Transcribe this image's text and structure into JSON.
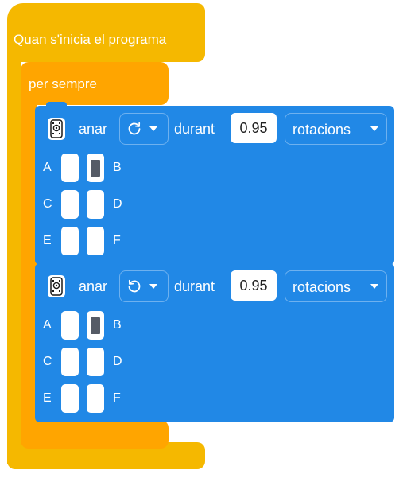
{
  "hat_block": {
    "label": "Quan s'inicia el programa",
    "color": "#f5b800"
  },
  "loop_block": {
    "label": "per sempre",
    "color": "#ffa500"
  },
  "motor_blocks": [
    {
      "action_label": "anar",
      "direction": "clockwise",
      "direction_icon": "rotate-clockwise-icon",
      "duration_label": "durant",
      "duration_value": "0.95",
      "unit_value": "rotacions",
      "ports": [
        {
          "left": "A",
          "right": "B",
          "left_active": false,
          "right_active": true
        },
        {
          "left": "C",
          "right": "D",
          "left_active": false,
          "right_active": false
        },
        {
          "left": "E",
          "right": "F",
          "left_active": false,
          "right_active": false
        }
      ]
    },
    {
      "action_label": "anar",
      "direction": "counterclockwise",
      "direction_icon": "rotate-counterclockwise-icon",
      "duration_label": "durant",
      "duration_value": "0.95",
      "unit_value": "rotacions",
      "ports": [
        {
          "left": "A",
          "right": "B",
          "left_active": false,
          "right_active": true
        },
        {
          "left": "C",
          "right": "D",
          "left_active": false,
          "right_active": false
        },
        {
          "left": "E",
          "right": "F",
          "left_active": false,
          "right_active": false
        }
      ]
    }
  ],
  "colors": {
    "motor_block": "#2188e6",
    "active_port": "#555b66"
  }
}
